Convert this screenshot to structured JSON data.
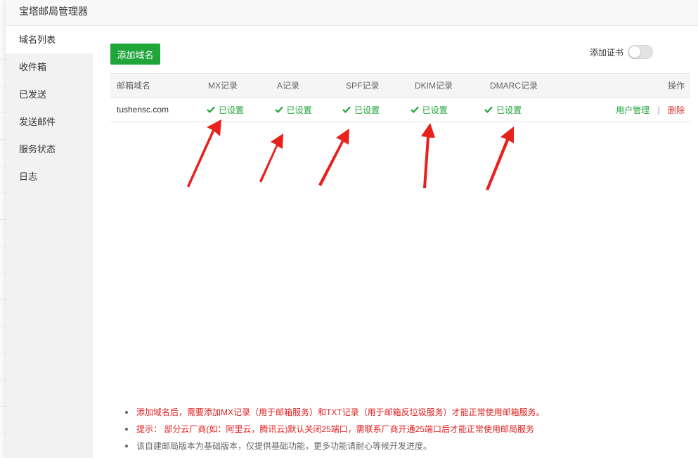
{
  "dialog": {
    "title": "宝塔邮局管理器"
  },
  "sidebar": {
    "items": [
      {
        "label": "域名列表",
        "active": true
      },
      {
        "label": "收件箱"
      },
      {
        "label": "已发送"
      },
      {
        "label": "发送邮件"
      },
      {
        "label": "服务状态"
      },
      {
        "label": "日志"
      }
    ]
  },
  "toolbar": {
    "add_domain_label": "添加域名",
    "add_cert_label": "添加证书",
    "add_cert_enabled": false
  },
  "table": {
    "headers": [
      "邮箱域名",
      "MX记录",
      "A记录",
      "SPF记录",
      "DKIM记录",
      "DMARC记录",
      "操作"
    ],
    "rows": [
      {
        "domain": "tushensc.com",
        "mx": "已设置",
        "a": "已设置",
        "spf": "已设置",
        "dkim": "已设置",
        "dmarc": "已设置",
        "action_user": "用户管理",
        "action_sep": "|",
        "action_delete": "删除"
      }
    ]
  },
  "notes": [
    "添加域名后，需要添加MX记录（用于邮箱服务）和TXT记录（用于邮箱反垃圾服务）才能正常使用邮箱服务。",
    "提示： 部分云厂商(如：阿里云，腾讯云)默认关闭25端口，需联系厂商开通25端口后才能正常使用邮局服务",
    "该自建邮局版本为基础版本，仅提供基础功能，更多功能请耐心等候开发进度。"
  ],
  "colors": {
    "primary": "#20a53a",
    "danger": "#e03131",
    "annotation_arrow": "#e8211c"
  },
  "icons": {
    "status": "check-icon"
  }
}
